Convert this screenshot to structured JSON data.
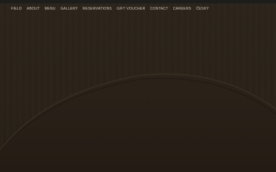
{
  "nav": {
    "items": [
      {
        "label": "FIELD"
      },
      {
        "label": "ABOUT"
      },
      {
        "label": "MENU"
      },
      {
        "label": "GALLERY"
      },
      {
        "label": "RESERVATIONS"
      },
      {
        "label": "GIFT VOUCHER"
      },
      {
        "label": "CONTACT"
      },
      {
        "label": "CAREERS"
      },
      {
        "label": "ČESKY"
      }
    ]
  },
  "colors": {
    "background": "#2a2119",
    "top_strip": "#1d1d1c",
    "nav_text": "#d2c9bb"
  }
}
